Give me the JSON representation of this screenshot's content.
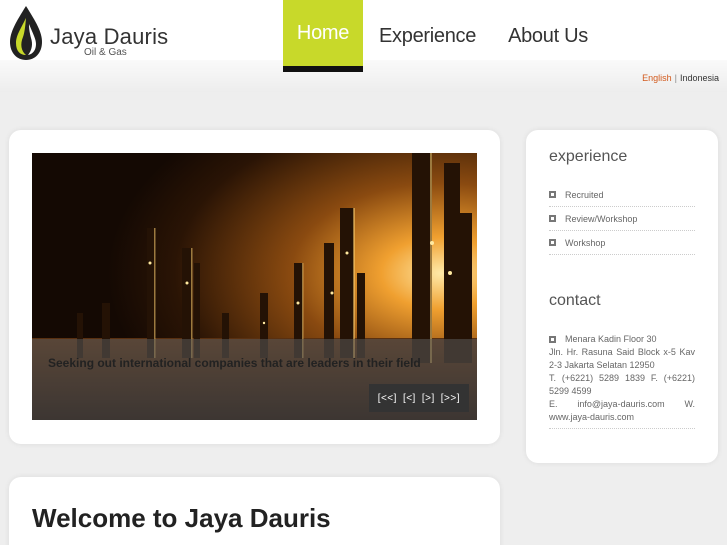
{
  "brand": {
    "title": "Jaya Dauris",
    "subtitle": "Oil & Gas",
    "colors": {
      "accent": "#c8d92a",
      "link": "#d25a1d"
    }
  },
  "nav": {
    "items": [
      {
        "label": "Home",
        "active": true
      },
      {
        "label": "Experience",
        "active": false
      },
      {
        "label": "About Us",
        "active": false
      }
    ]
  },
  "language": {
    "english": "English",
    "separator": "|",
    "indonesia": "Indonesia"
  },
  "slider": {
    "caption": "Seeking out international companies that are leaders in their field",
    "controls": {
      "first": "[<<]",
      "prev": "[<]",
      "next": "[>]",
      "last": "[>>]"
    }
  },
  "sidebar": {
    "experience_title": "experience",
    "experience_items": [
      "Recruited",
      "Review/Workshop",
      "Workshop"
    ],
    "contact_title": "contact",
    "contact": {
      "line1": "Menara Kadin Floor 30",
      "line2": "Jln. Hr. Rasuna Said Block x-5 Kav",
      "line3": "2-3 Jakarta Selatan 12950",
      "line4": "T. (+6221) 5289 1839 F. (+6221)",
      "line5": "5299 4599",
      "line6": "E. info@jaya-dauris.com W.",
      "line7": "www.jaya-dauris.com"
    }
  },
  "welcome": {
    "title": "Welcome to Jaya Dauris"
  },
  "icons": {
    "logo": "flame-drop-logo-icon",
    "bullet": "square-bullet-icon"
  }
}
